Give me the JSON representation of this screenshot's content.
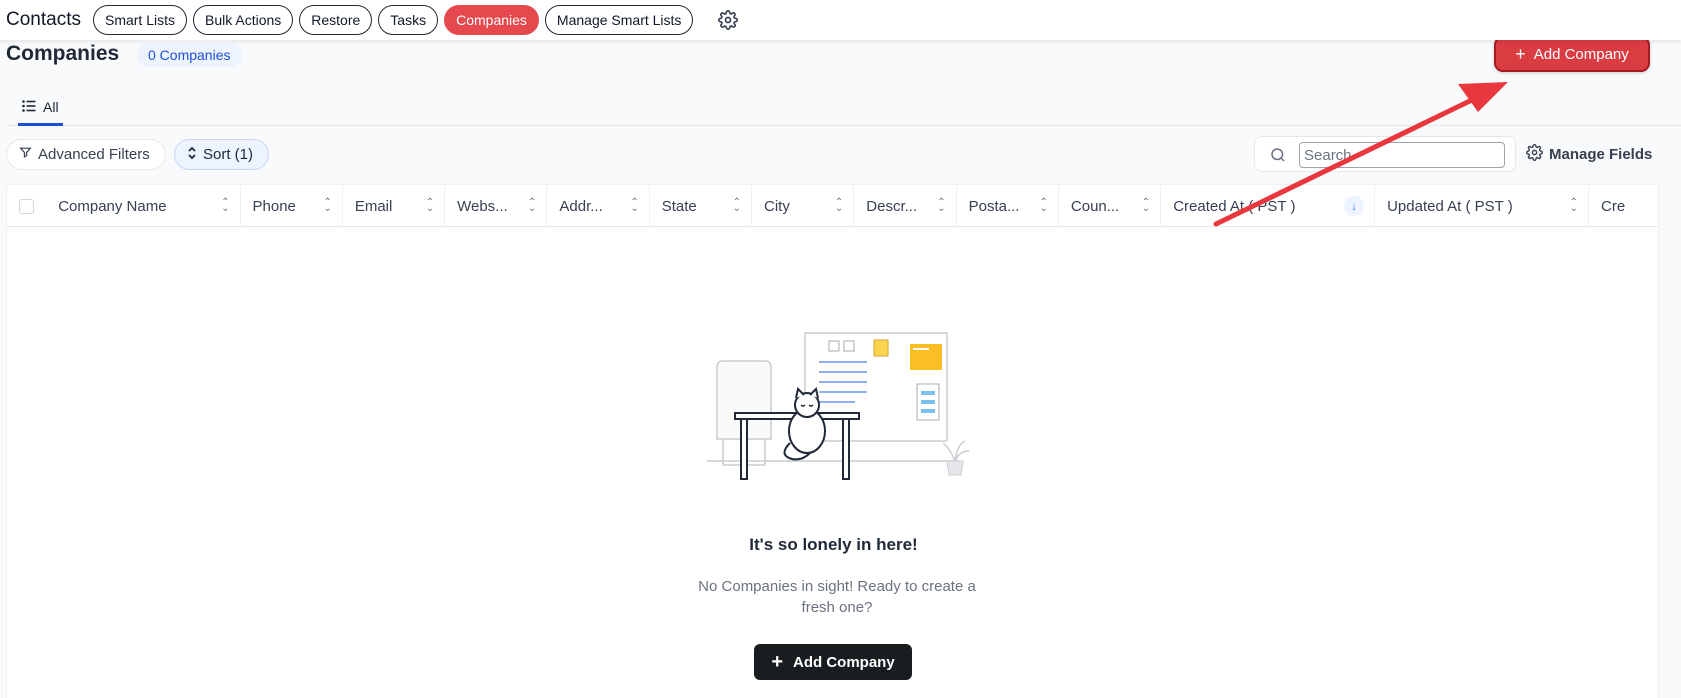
{
  "topbar": {
    "title": "Contacts",
    "pills": [
      {
        "label": "Smart Lists",
        "active": false
      },
      {
        "label": "Bulk Actions",
        "active": false
      },
      {
        "label": "Restore",
        "active": false
      },
      {
        "label": "Tasks",
        "active": false
      },
      {
        "label": "Companies",
        "active": true
      },
      {
        "label": "Manage Smart Lists",
        "active": false
      }
    ],
    "settings_icon": "gear-icon"
  },
  "header": {
    "title": "Companies",
    "count_badge": "0 Companies",
    "add_button_label": "Add Company",
    "add_button_icon": "plus-icon"
  },
  "tabs": [
    {
      "label": "All",
      "icon": "list-icon",
      "active": true
    }
  ],
  "filters": {
    "advanced_label": "Advanced Filters",
    "sort_label": "Sort (1)",
    "search_placeholder": "Search",
    "manage_fields_label": "Manage Fields"
  },
  "table": {
    "columns": [
      {
        "label": "Company Name",
        "sorted": false
      },
      {
        "label": "Phone",
        "sorted": false
      },
      {
        "label": "Email",
        "sorted": false
      },
      {
        "label": "Webs...",
        "sorted": false
      },
      {
        "label": "Addr...",
        "sorted": false
      },
      {
        "label": "State",
        "sorted": false
      },
      {
        "label": "City",
        "sorted": false
      },
      {
        "label": "Descr...",
        "sorted": false
      },
      {
        "label": "Posta...",
        "sorted": false
      },
      {
        "label": "Coun...",
        "sorted": false
      },
      {
        "label": "Created At ( PST )",
        "sorted": true
      },
      {
        "label": "Updated At ( PST )",
        "sorted": false
      },
      {
        "label": "Cre",
        "sorted": false
      }
    ]
  },
  "empty_state": {
    "title": "It's so lonely in here!",
    "subtitle": "No Companies in sight! Ready to create a fresh one?",
    "button_label": "Add Company"
  },
  "colors": {
    "accent_red": "#d93c41",
    "accent_blue": "#1d4ed8",
    "annotation_arrow": "#e8383d"
  }
}
